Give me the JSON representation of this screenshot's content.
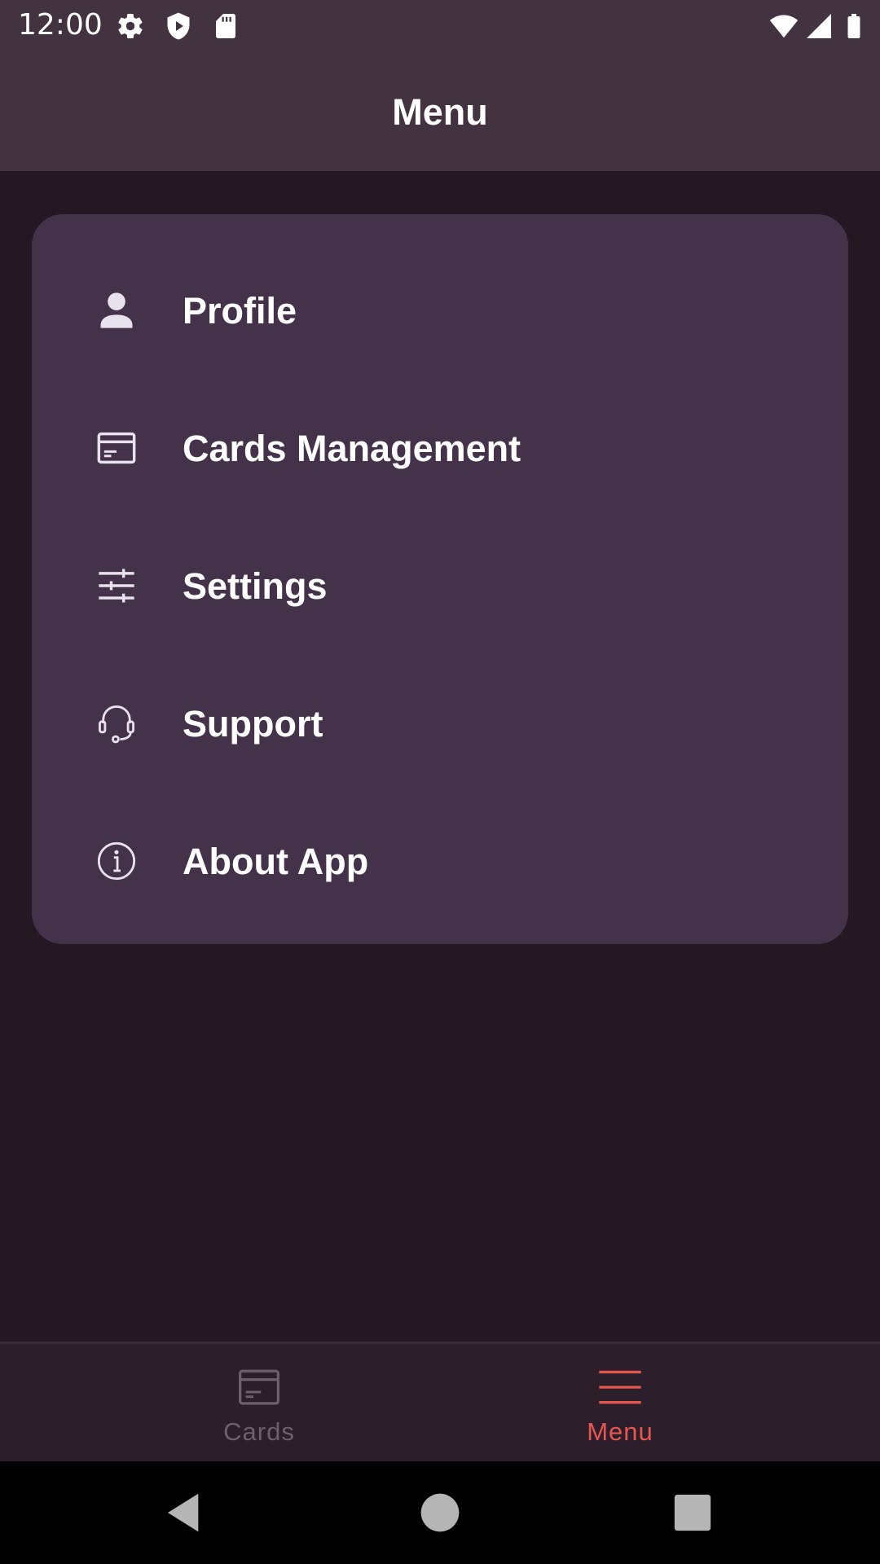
{
  "status_bar": {
    "time": "12:00",
    "left_icons": [
      "gear-icon",
      "shield-play-icon",
      "sd-card-icon"
    ],
    "right_icons": [
      "wifi-icon",
      "cell-signal-icon",
      "battery-icon"
    ]
  },
  "app_bar": {
    "title": "Menu"
  },
  "menu": {
    "items": [
      {
        "label": "Profile",
        "icon": "person-icon"
      },
      {
        "label": "Cards Management",
        "icon": "credit-card-icon"
      },
      {
        "label": "Settings",
        "icon": "sliders-icon"
      },
      {
        "label": "Support",
        "icon": "headset-icon"
      },
      {
        "label": "About App",
        "icon": "info-icon"
      }
    ]
  },
  "bottom_nav": {
    "tabs": [
      {
        "label": "Cards",
        "icon": "credit-card-icon",
        "selected": false
      },
      {
        "label": "Menu",
        "icon": "hamburger-menu-icon",
        "selected": true
      }
    ]
  },
  "system_nav": {
    "buttons": [
      "back-icon",
      "home-icon",
      "recents-icon"
    ]
  },
  "colors": {
    "top_bar_bg": "#43323f",
    "screen_bg": "#241822",
    "card_bg": "#43324a",
    "accent_active": "#e5574f",
    "inactive": "#6d5f6b",
    "icon_light": "#e8e1ee"
  }
}
